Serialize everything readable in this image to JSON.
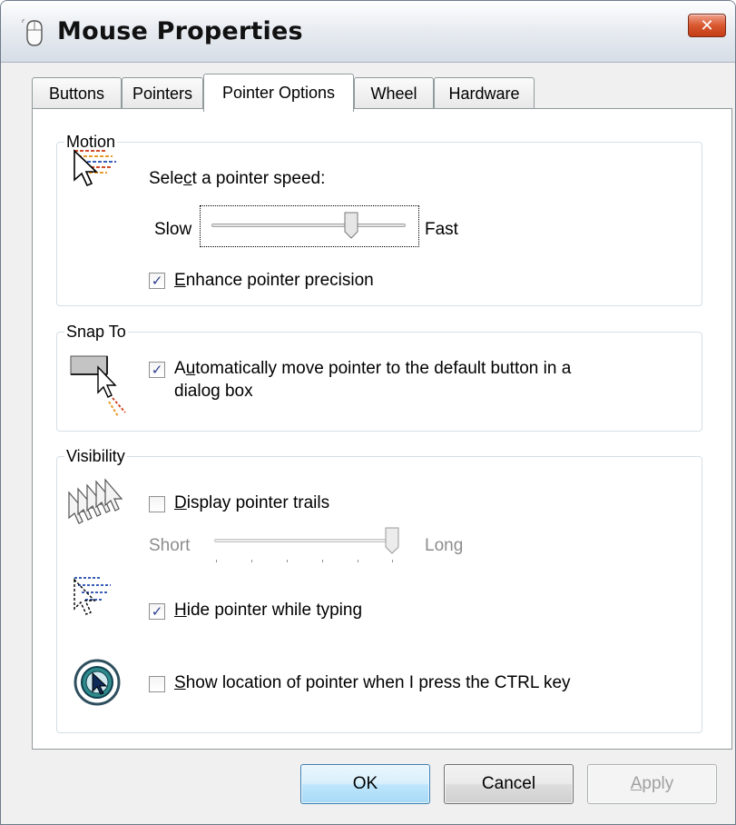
{
  "window": {
    "title": "Mouse Properties",
    "close_glyph": "✕"
  },
  "tabs": [
    "Buttons",
    "Pointers",
    "Pointer Options",
    "Wheel",
    "Hardware"
  ],
  "active_tab": "Pointer Options",
  "motion": {
    "legend": "Motion",
    "speed_label_pre": "Sele",
    "speed_label_key": "c",
    "speed_label_post": "t a pointer speed:",
    "slow_label": "Slow",
    "fast_label": "Fast",
    "speed_value_fraction": 0.72,
    "enhance_key": "E",
    "enhance_rest": "nhance pointer precision",
    "enhance_checked": true
  },
  "snap": {
    "legend": "Snap To",
    "auto_pre": "A",
    "auto_key": "u",
    "auto_rest": "tomatically move pointer to the default button in a",
    "auto_line2": "dialog box",
    "auto_checked": true
  },
  "visibility": {
    "legend": "Visibility",
    "trails_key": "D",
    "trails_rest": "isplay pointer trails",
    "trails_checked": false,
    "short_label": "Short",
    "long_label": "Long",
    "trails_value_fraction": 1.0,
    "hide_key": "H",
    "hide_rest": "ide pointer while typing",
    "hide_checked": true,
    "show_key": "S",
    "show_rest": "how location of pointer when I press the CTRL key",
    "show_checked": false
  },
  "buttons": {
    "ok": "OK",
    "cancel": "Cancel",
    "apply_key": "A",
    "apply_rest": "pply"
  },
  "colors": {
    "checkmark": "#2b3c8f",
    "default_button_border": "#3c7fb1",
    "close_red": "#c33c14"
  },
  "icons": [
    "mouse-icon",
    "close-icon",
    "pointer-speed-icon",
    "snap-to-icon",
    "pointer-trails-icon",
    "hide-pointer-icon",
    "pointer-location-icon",
    "checkmark-icon"
  ]
}
